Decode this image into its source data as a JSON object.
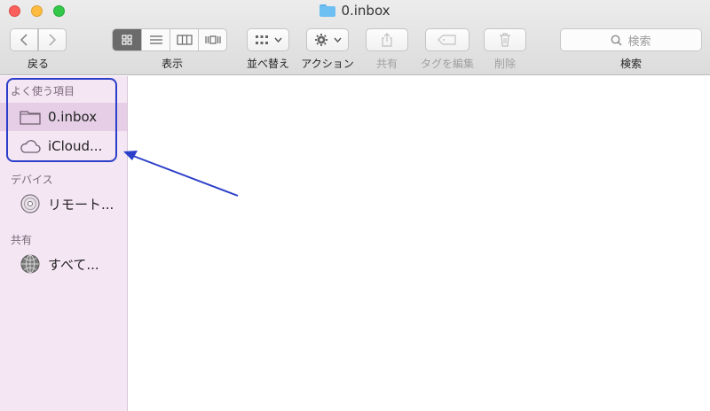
{
  "window": {
    "title": "0.inbox"
  },
  "toolbar": {
    "back_label": "戻る",
    "view_label": "表示",
    "arrange_label": "並べ替え",
    "action_label": "アクション",
    "share_label": "共有",
    "tags_label": "タグを編集",
    "delete_label": "削除",
    "search_label": "検索",
    "search_placeholder": "検索"
  },
  "sidebar": {
    "favorites_title": "よく使う項目",
    "favorites": [
      {
        "label": "0.inbox",
        "icon": "folder-icon",
        "selected": true
      },
      {
        "label": "iCloud...",
        "icon": "cloud-icon",
        "selected": false
      }
    ],
    "devices_title": "デバイス",
    "devices": [
      {
        "label": "リモート...",
        "icon": "disc-icon"
      }
    ],
    "shared_title": "共有",
    "shared": [
      {
        "label": "すべて...",
        "icon": "network-icon"
      }
    ]
  },
  "colors": {
    "sidebar_bg": "#f5e6f4",
    "selection_bg": "#e6cfe6",
    "annotation": "#2c3fc9"
  }
}
